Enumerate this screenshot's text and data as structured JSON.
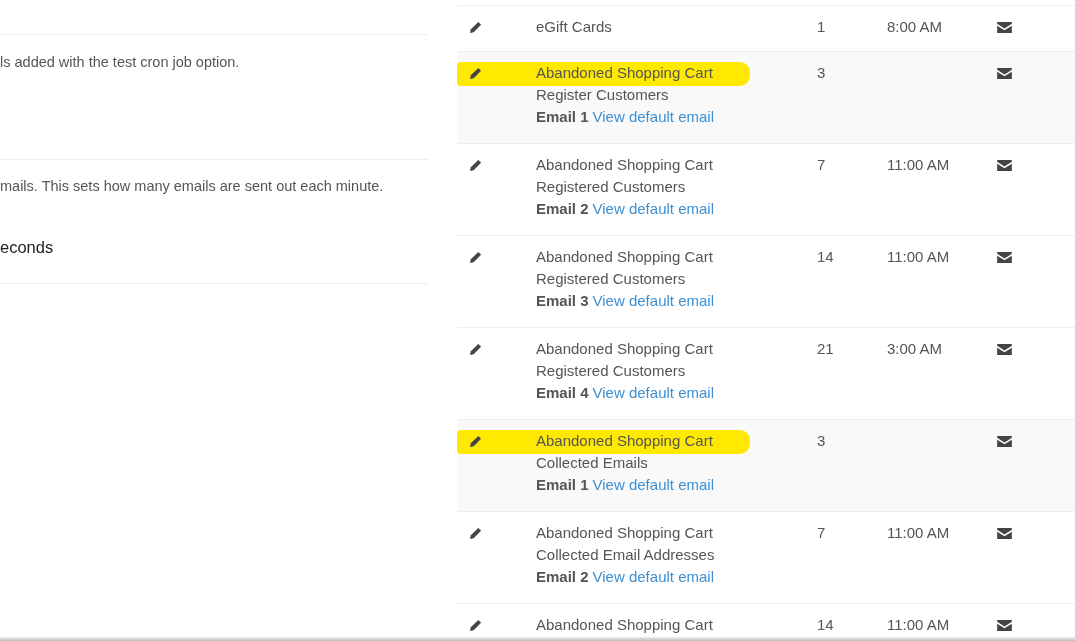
{
  "settings": [
    {
      "description": "ls added with the test cron job option."
    },
    {
      "description": "mails. This sets how many emails are sent out each minute."
    },
    {
      "value": "econds"
    }
  ],
  "email_table": {
    "rows": [
      {
        "title": "eGift Cards",
        "count": "1",
        "time": "8:00 AM",
        "highlighted": false
      },
      {
        "title": "Abandoned Shopping Cart",
        "subtitle": "Register Customers",
        "email_label": "Email 1",
        "link": "View default email",
        "count": "3",
        "highlighted": true
      },
      {
        "title": "Abandoned Shopping Cart",
        "subtitle": "Registered Customers",
        "email_label": "Email 2",
        "link": "View default email",
        "count": "7",
        "time": "11:00 AM",
        "highlighted": false
      },
      {
        "title": "Abandoned Shopping Cart",
        "subtitle": "Registered Customers",
        "email_label": "Email 3",
        "link": "View default email",
        "count": "14",
        "time": "11:00 AM",
        "highlighted": false
      },
      {
        "title": "Abandoned Shopping Cart",
        "subtitle": "Registered Customers",
        "email_label": "Email 4",
        "link": "View default email",
        "count": "21",
        "time": "3:00 AM",
        "highlighted": false
      },
      {
        "title": "Abandoned Shopping Cart",
        "subtitle": "Collected Emails",
        "email_label": "Email 1",
        "link": "View default email",
        "count": "3",
        "highlighted": true
      },
      {
        "title": "Abandoned Shopping Cart",
        "subtitle": "Collected Email Addresses",
        "email_label": "Email 2",
        "link": "View default email",
        "count": "7",
        "time": "11:00 AM",
        "highlighted": false
      },
      {
        "title": "Abandoned Shopping Cart",
        "count": "14",
        "time": "11:00 AM",
        "highlighted": false
      }
    ]
  }
}
